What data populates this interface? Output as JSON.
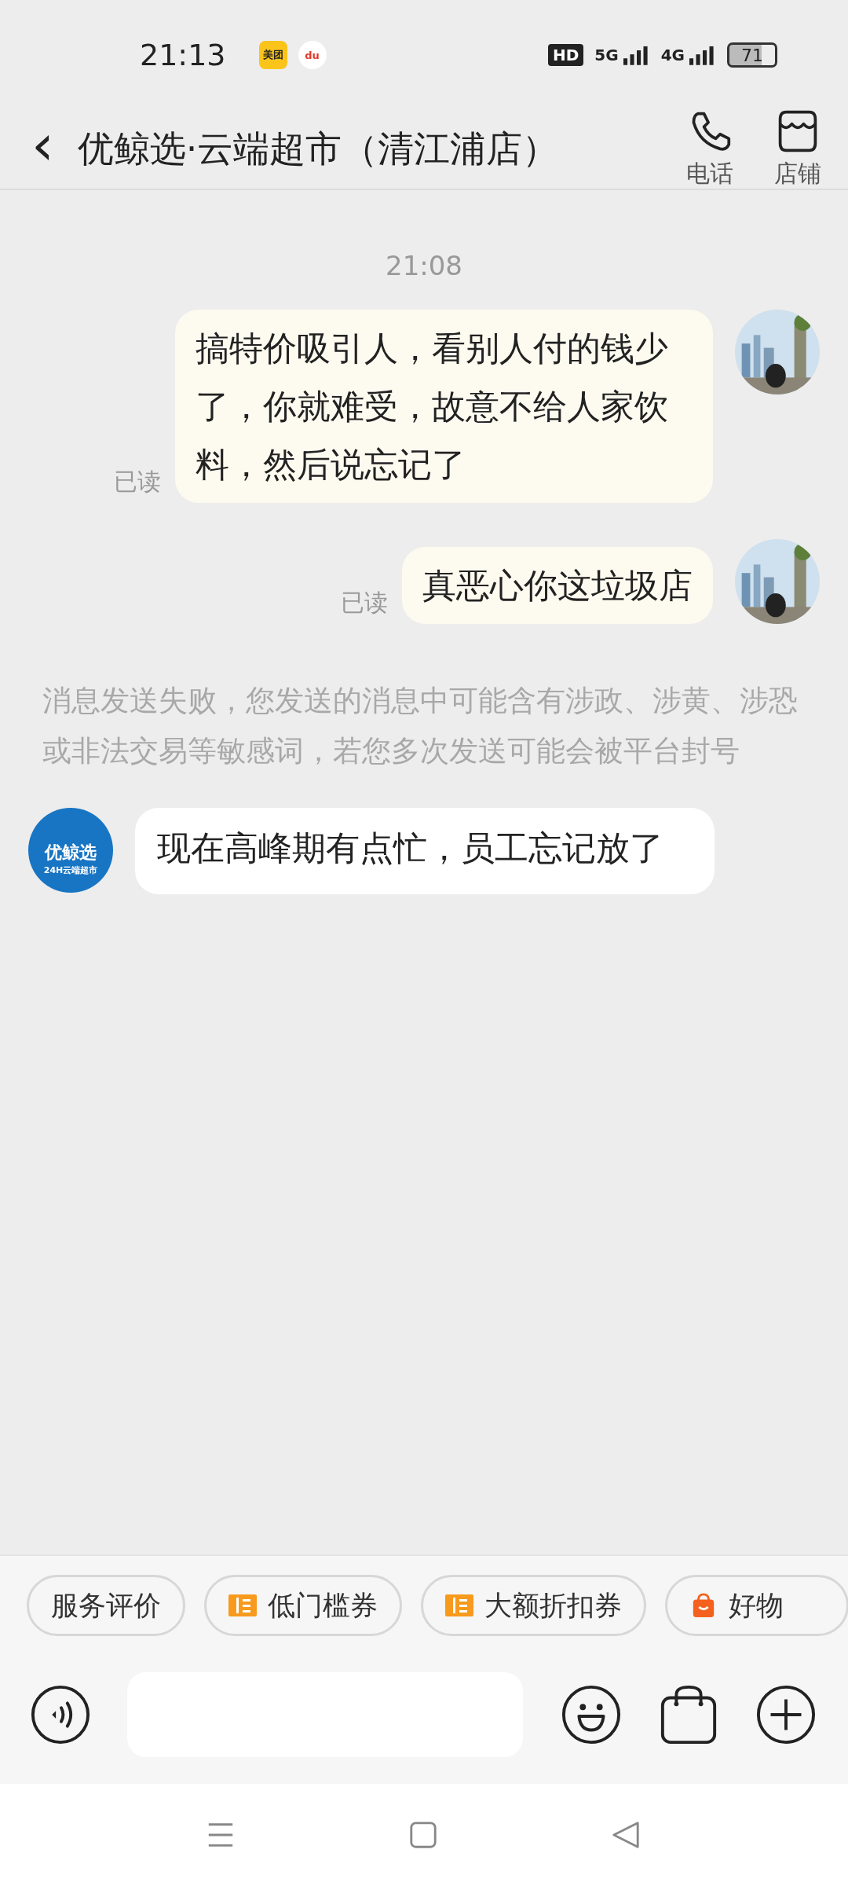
{
  "status_bar": {
    "time": "21:13",
    "apps": [
      {
        "kind": "meituan",
        "label": "美团"
      },
      {
        "kind": "map",
        "label": "du"
      }
    ],
    "hd": "HD",
    "net1": "5G",
    "net2": "4G",
    "battery": "71"
  },
  "header": {
    "back": "‹",
    "title": "优鲸选·云端超市（清江浦店）",
    "actions": [
      {
        "kind": "phone",
        "label": "电话"
      },
      {
        "kind": "store",
        "label": "店铺"
      }
    ]
  },
  "messages": [
    {
      "kind": "time",
      "text": "21:08"
    },
    {
      "kind": "sent",
      "text": "搞特价吸引人，看别人付的钱少了，你就难受，故意不给人家饮料，然后说忘记了",
      "receipt": "已读"
    },
    {
      "kind": "sent",
      "text": "真恶心你这垃圾店",
      "receipt": "已读"
    },
    {
      "kind": "notice",
      "text": "消息发送失败，您发送的消息中可能含有涉政、涉黄、涉恐或非法交易等敏感词，若您多次发送可能会被平台封号"
    },
    {
      "kind": "received",
      "text": "现在高峰期有点忙，员工忘记放了",
      "avatar_name": "优鲸选",
      "avatar_sub": "24H云端超市"
    }
  ],
  "chips": [
    {
      "kind": "plain",
      "label": "服务评价"
    },
    {
      "kind": "ticket",
      "label": "低门槛券"
    },
    {
      "kind": "ticket",
      "label": "大额折扣券"
    },
    {
      "kind": "bag",
      "label": "好物"
    }
  ]
}
